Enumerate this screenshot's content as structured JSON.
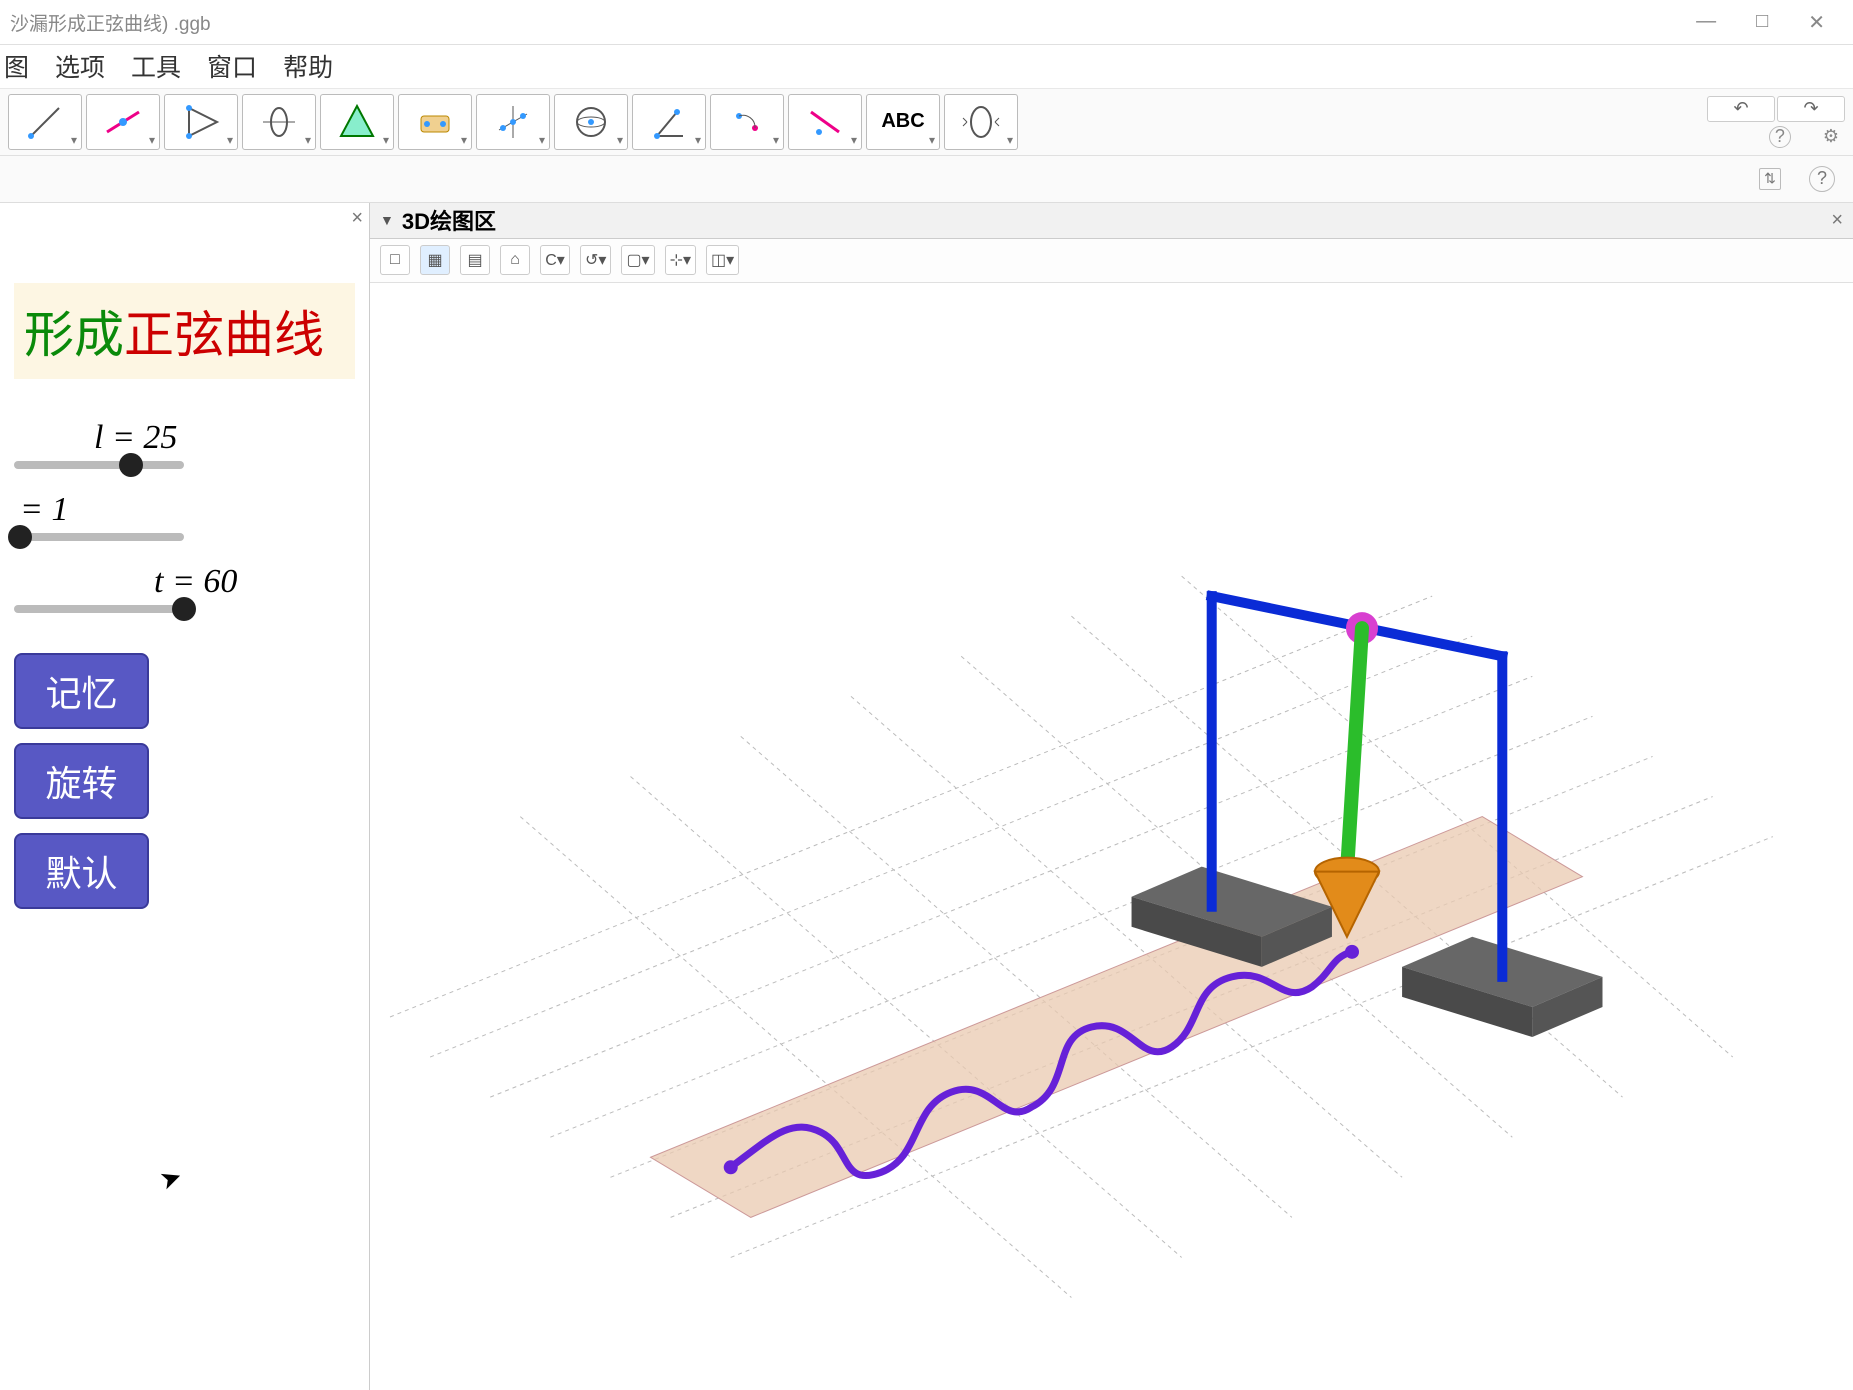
{
  "window": {
    "title_suffix": "沙漏形成正弦曲线) .ggb",
    "controls": {
      "min": "—",
      "max": "□",
      "close": "✕"
    }
  },
  "menu": {
    "items": [
      "图",
      "选项",
      "工具",
      "窗口",
      "帮助"
    ]
  },
  "toolbar": {
    "undo": "↶",
    "redo": "↷",
    "help_icon": "?",
    "gear": "⚙"
  },
  "secbar": {
    "sort": "⇅",
    "help": "?"
  },
  "left": {
    "close": "×",
    "title_green": "形成",
    "title_red": "正弦曲线",
    "sliders": {
      "l": {
        "label": "l = 25",
        "pos": 0.62
      },
      "eq": {
        "label": "= 1",
        "pos": 0.02
      },
      "t": {
        "label": "t = 60",
        "pos": 0.92
      }
    },
    "buttons": {
      "memory": "记忆",
      "rotate": "旋转",
      "default": "默认"
    }
  },
  "right": {
    "header": "3D绘图区",
    "close": "×",
    "subtools": [
      "□",
      "▦",
      "▤",
      "⌂",
      "C▾",
      "↺▾",
      "▢▾",
      "⊹▾",
      "◫▾"
    ]
  }
}
